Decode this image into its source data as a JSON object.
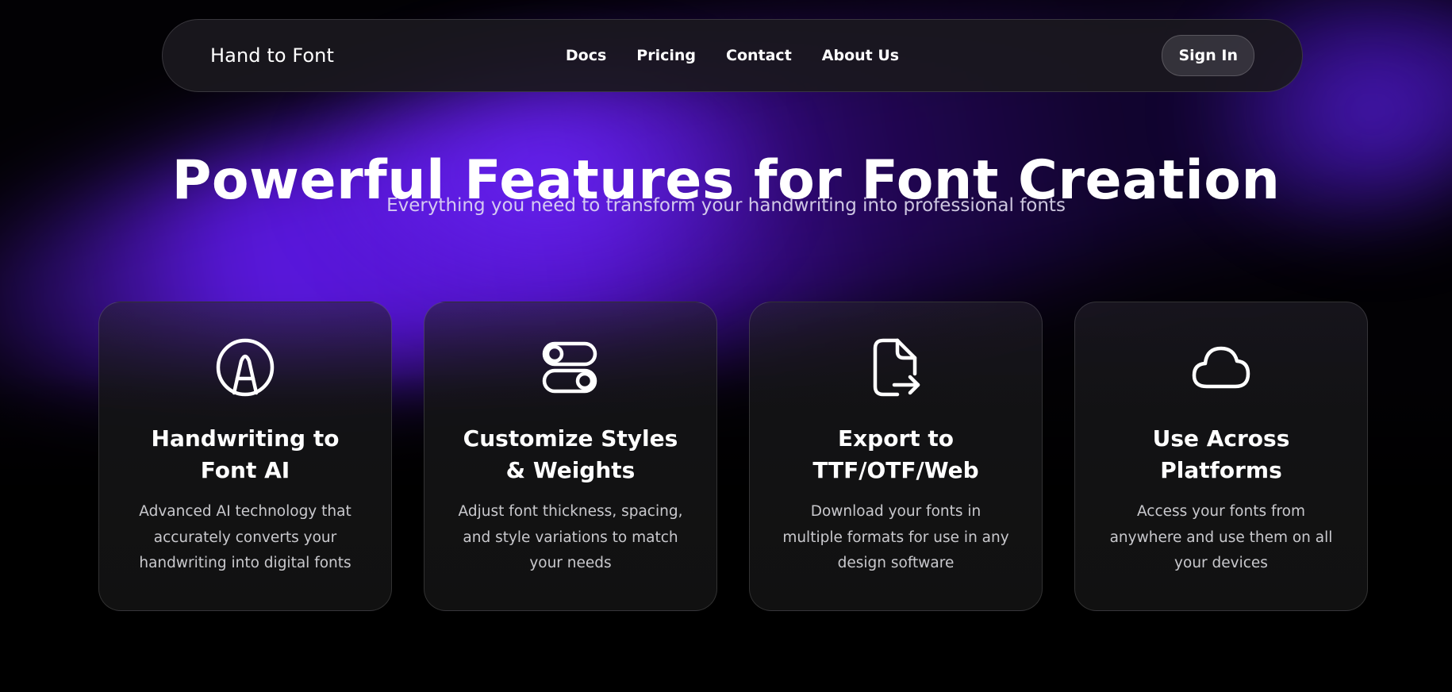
{
  "header": {
    "brand": "Hand to Font",
    "nav": [
      {
        "label": "Docs"
      },
      {
        "label": "Pricing"
      },
      {
        "label": "Contact"
      },
      {
        "label": "About Us"
      }
    ],
    "sign_in_label": "Sign In"
  },
  "hero": {
    "title": "Powerful Features for Font Creation",
    "subtitle": "Everything you need to transform your handwriting into professional fonts"
  },
  "features": [
    {
      "icon": "handwriting-a-icon",
      "title": "Handwriting to Font AI",
      "description": "Advanced AI technology that accurately converts your handwriting into digital fonts"
    },
    {
      "icon": "toggle-icon",
      "title": "Customize Styles & Weights",
      "description": "Adjust font thickness, spacing, and style variations to match your needs"
    },
    {
      "icon": "file-export-icon",
      "title": "Export to TTF/OTF/Web",
      "description": "Download your fonts in multiple formats for use in any design software"
    },
    {
      "icon": "cloud-icon",
      "title": "Use Across Platforms",
      "description": "Access your fonts from anywhere and use them on all your devices"
    }
  ],
  "colors": {
    "background": "#000000",
    "accent_glow": "#5b16e6",
    "card_border": "#2a2a2e"
  }
}
